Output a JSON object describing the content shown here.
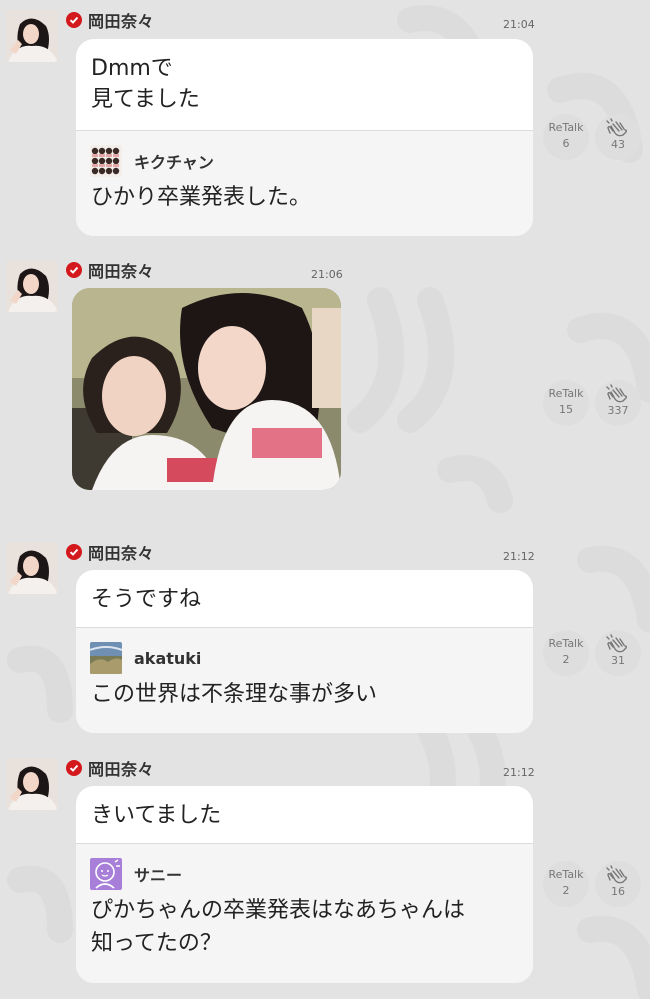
{
  "messages": [
    {
      "author": "岡田奈々",
      "time": "21:04",
      "text_lines": [
        "Dmmで",
        "見てました"
      ],
      "quote": {
        "name": "キクチャン",
        "avatar": "group-photo-avatar",
        "text_lines": [
          "ひかり卒業発表した。"
        ]
      },
      "retalk_label": "ReTalk",
      "retalk_count": "6",
      "clap_count": "43"
    },
    {
      "author": "岡田奈々",
      "time": "21:06",
      "photo": "two-girls-selfie-photo",
      "retalk_label": "ReTalk",
      "retalk_count": "15",
      "clap_count": "337"
    },
    {
      "author": "岡田奈々",
      "time": "21:12",
      "text_lines": [
        "そうですね"
      ],
      "quote": {
        "name": "akatuki",
        "avatar": "landscape-avatar",
        "text_lines": [
          "この世界は不条理な事が多い"
        ]
      },
      "retalk_label": "ReTalk",
      "retalk_count": "2",
      "clap_count": "31"
    },
    {
      "author": "岡田奈々",
      "time": "21:12",
      "text_lines": [
        "きいてました"
      ],
      "quote": {
        "name": "サニー",
        "avatar": "purple-face-avatar",
        "text_lines": [
          "ぴかちゃんの卒業発表はなあちゃんは",
          "知ってたの？"
        ]
      },
      "retalk_label": "ReTalk",
      "retalk_count": "2",
      "clap_count": "16"
    }
  ],
  "icons": {
    "verified": "verified-check-icon",
    "clap": "clap-hands-icon",
    "watermark": "talk-watermark-pattern"
  },
  "colors": {
    "background": "#e3e3e3",
    "bubble": "#ffffff",
    "quote_bg": "#f5f5f5",
    "verified": "#d4191c",
    "action_circle": "#dedede"
  }
}
